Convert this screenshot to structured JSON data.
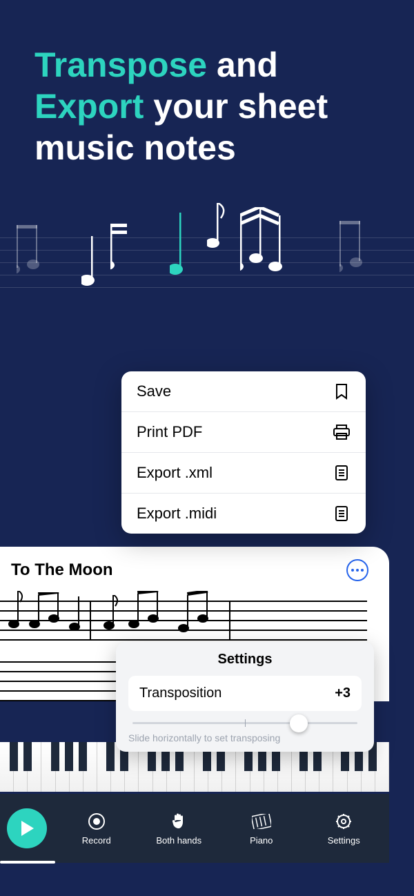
{
  "headline": {
    "w1": "Transpose",
    "w2": "and",
    "w3": "Export",
    "w4": "your sheet music notes"
  },
  "menu": {
    "save": "Save",
    "print": "Print PDF",
    "xml": "Export .xml",
    "midi": "Export .midi"
  },
  "song": {
    "title": "To The Moon"
  },
  "settings": {
    "title": "Settings",
    "transposition_label": "Transposition",
    "transposition_value": "+3",
    "hint": "Slide horizontally to set transposing"
  },
  "nav": {
    "record": "Record",
    "hands": "Both hands",
    "piano": "Piano",
    "settings": "Settings"
  }
}
